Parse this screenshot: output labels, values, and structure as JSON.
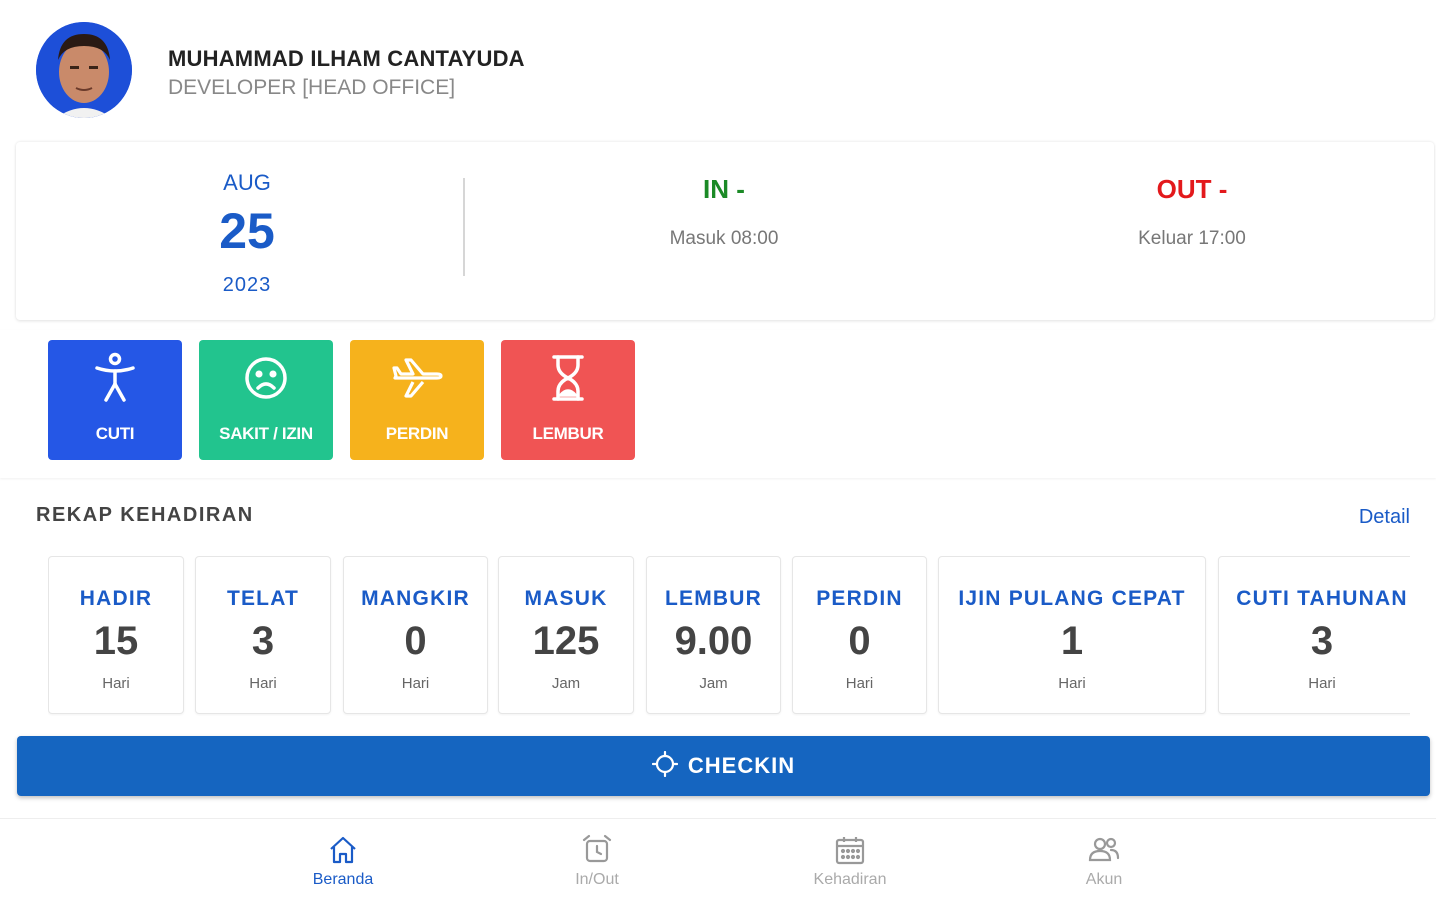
{
  "user": {
    "name": "MUHAMMAD ILHAM CANTAYUDA",
    "role": "DEVELOPER [HEAD OFFICE]"
  },
  "date": {
    "month": "AUG",
    "day": "25",
    "year": "2023"
  },
  "attendance": {
    "in_label": "IN -",
    "in_sub": "Masuk 08:00",
    "out_label": "OUT -",
    "out_sub": "Keluar 17:00"
  },
  "actions": [
    {
      "label": "CUTI",
      "icon": "accessibility-icon",
      "color": "#2557e6"
    },
    {
      "label": "SAKIT / IZIN",
      "icon": "sad-face-icon",
      "color": "#22c48e"
    },
    {
      "label": "PERDIN",
      "icon": "airplane-icon",
      "color": "#f6b21c"
    },
    {
      "label": "LEMBUR",
      "icon": "hourglass-icon",
      "color": "#f05454"
    }
  ],
  "rekap": {
    "title": "REKAP KEHADIRAN",
    "detail_link": "Detail",
    "items": [
      {
        "title": "HADIR",
        "value": "15",
        "unit": "Hari"
      },
      {
        "title": "TELAT",
        "value": "3",
        "unit": "Hari"
      },
      {
        "title": "MANGKIR",
        "value": "0",
        "unit": "Hari"
      },
      {
        "title": "MASUK",
        "value": "125",
        "unit": "Jam"
      },
      {
        "title": "LEMBUR",
        "value": "9.00",
        "unit": "Jam"
      },
      {
        "title": "PERDIN",
        "value": "0",
        "unit": "Hari"
      },
      {
        "title": "IJIN PULANG CEPAT",
        "value": "1",
        "unit": "Hari"
      },
      {
        "title": "CUTI TAHUNAN",
        "value": "3",
        "unit": "Hari"
      }
    ]
  },
  "checkin": {
    "label": "CHECKIN",
    "icon": "crosshair-icon"
  },
  "nav": {
    "active": "Beranda",
    "items": [
      {
        "label": "Beranda",
        "icon": "home-icon"
      },
      {
        "label": "In/Out",
        "icon": "alarm-clock-icon"
      },
      {
        "label": "Kehadiran",
        "icon": "calendar-icon"
      },
      {
        "label": "Akun",
        "icon": "users-icon"
      }
    ]
  },
  "colors": {
    "primary": "#1a5bc7",
    "in": "#1b8a26",
    "out": "#e3191c",
    "checkin": "#1565c0"
  }
}
